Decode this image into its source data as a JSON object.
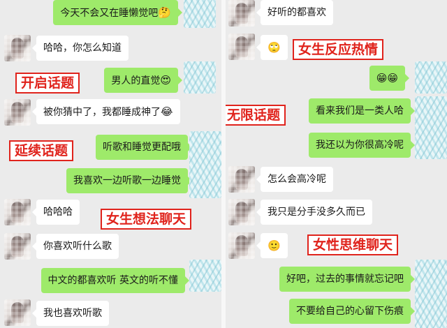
{
  "left_panel": {
    "messages": [
      {
        "side": "right",
        "text": "今天不会又在睡懒觉吧",
        "emoji": "🤔"
      },
      {
        "side": "left",
        "text": "哈哈，你怎么知道",
        "emoji": ""
      },
      {
        "side": "right",
        "text": "男人的直觉",
        "emoji": "😍"
      },
      {
        "side": "left",
        "text": "被你猜中了，我都睡成神了",
        "emoji": "😂"
      },
      {
        "side": "right",
        "text": "听歌和睡觉更配哦",
        "emoji": ""
      },
      {
        "side": "right",
        "text": "我喜欢一边听歌一边睡觉",
        "emoji": ""
      },
      {
        "side": "left",
        "text": "哈哈哈",
        "emoji": ""
      },
      {
        "side": "left",
        "text": "你喜欢听什么歌",
        "emoji": ""
      },
      {
        "side": "right",
        "text": "中文的都喜欢听 英文的听不懂",
        "emoji": ""
      },
      {
        "side": "left",
        "text": "我也喜欢听歌",
        "emoji": ""
      }
    ],
    "labels": [
      "开启话题",
      "延续话题",
      "女生想法聊天"
    ]
  },
  "right_panel": {
    "messages": [
      {
        "side": "left",
        "text": "好听的都喜欢",
        "emoji": ""
      },
      {
        "side": "left",
        "text": "",
        "emoji": "🙄"
      },
      {
        "side": "right",
        "text": "",
        "emoji": "😁😁"
      },
      {
        "side": "right",
        "text": "看来我们是一类人哈",
        "emoji": ""
      },
      {
        "side": "right",
        "text": "我还以为你很高冷呢",
        "emoji": ""
      },
      {
        "side": "left",
        "text": "怎么会高冷呢",
        "emoji": ""
      },
      {
        "side": "left",
        "text": "我只是分手没多久而已",
        "emoji": ""
      },
      {
        "side": "left",
        "text": "",
        "emoji": "🙂"
      },
      {
        "side": "right",
        "text": "好吧，过去的事情就忘记吧",
        "emoji": ""
      },
      {
        "side": "right",
        "text": "不要给自己的心留下伤痕",
        "emoji": ""
      }
    ],
    "labels": [
      "女生反应热情",
      "无限话题",
      "女性思维聊天"
    ]
  },
  "colors": {
    "sent_bubble": "#9eea6a",
    "received_bubble": "#ffffff",
    "background": "#ebebeb",
    "label_red": "#e0231c"
  }
}
